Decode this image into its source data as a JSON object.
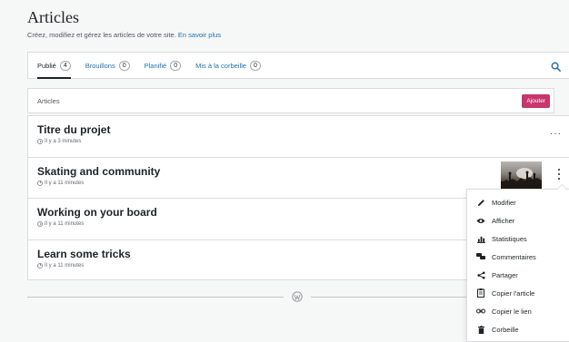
{
  "header": {
    "title": "Articles",
    "subtitle": "Créez, modifiez et gérez les articles de votre site.",
    "learn_more": "En savoir plus"
  },
  "tabs": [
    {
      "label": "Publié",
      "count": "4",
      "active": true
    },
    {
      "label": "Brouillons",
      "count": "0",
      "active": false
    },
    {
      "label": "Planifié",
      "count": "0",
      "active": false
    },
    {
      "label": "Mis à la corbeille",
      "count": "0",
      "active": false
    }
  ],
  "list_header": {
    "label": "Articles",
    "add_button": "Ajouter"
  },
  "posts": [
    {
      "title": "Titre du projet",
      "time": "Il y a 3 minutes"
    },
    {
      "title": "Skating and community",
      "time": "Il y a 11 minutes"
    },
    {
      "title": "Working on your board",
      "time": "Il y a 11 minutes"
    },
    {
      "title": "Learn some tricks",
      "time": "Il y a 11 minutes"
    }
  ],
  "menu": {
    "items": [
      {
        "label": "Modifier",
        "icon": "pencil-icon"
      },
      {
        "label": "Afficher",
        "icon": "eye-icon"
      },
      {
        "label": "Statistiques",
        "icon": "bar-chart-icon"
      },
      {
        "label": "Commentaires",
        "icon": "comments-icon"
      },
      {
        "label": "Partager",
        "icon": "share-icon"
      },
      {
        "label": "Copier l'article",
        "icon": "copy-icon"
      },
      {
        "label": "Copier le lien",
        "icon": "link-icon"
      },
      {
        "label": "Corbeille",
        "icon": "trash-icon"
      }
    ]
  },
  "colors": {
    "accent": "#2271b1",
    "primary_button": "#c9356e",
    "background": "#f6f7f7"
  }
}
